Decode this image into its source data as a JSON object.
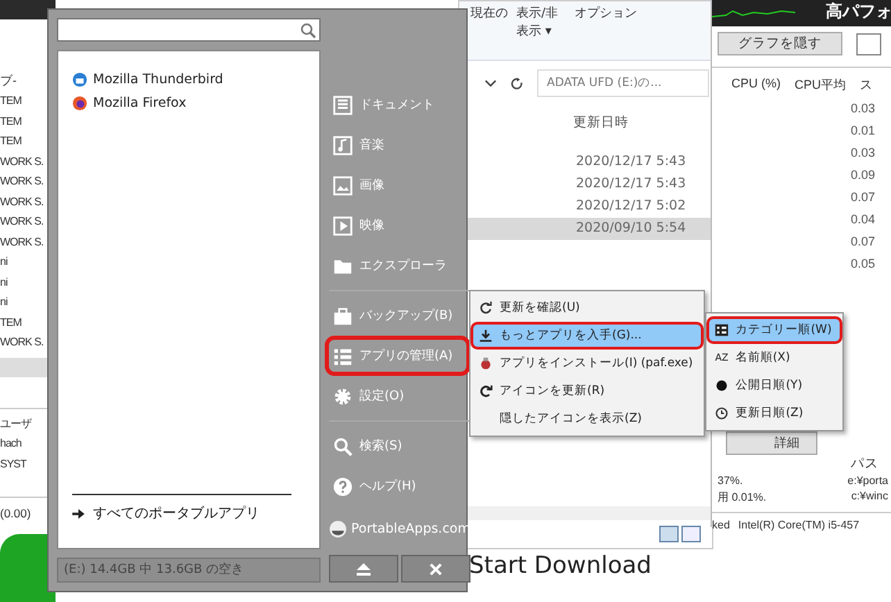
{
  "left_window": {
    "column_header": "ブ‐",
    "rows": [
      "TEM",
      "TEM",
      "TEM",
      "WORK S.",
      "WORK S.",
      "WORK S.",
      "WORK S.",
      "WORK S.",
      "ni",
      "ni",
      "ni",
      "TEM",
      "WORK S."
    ],
    "lower_header": "ユーザ",
    "lower_rows": [
      "hach",
      "SYST"
    ],
    "status": "(0.00)"
  },
  "explorer": {
    "ribbon": [
      "現在の",
      "表示/非表示 ▾",
      "オプション"
    ],
    "search_placeholder": "ADATA UFD (E:)の...",
    "column_header": "更新日時",
    "dates": [
      {
        "text": "2020/12/17 5:43",
        "selected": false
      },
      {
        "text": "2020/12/17 5:43",
        "selected": false
      },
      {
        "text": "2020/12/17 5:02",
        "selected": false
      },
      {
        "text": "2020/09/10 5:54",
        "selected": true
      }
    ],
    "below_text": "Start Download"
  },
  "task_manager": {
    "title": "高パフォ",
    "hide_graph_button": "グラフを隠す",
    "columns": [
      "CPU (%)",
      "CPU平均",
      "ス"
    ],
    "cpu_avg": [
      "0.03",
      "0.01",
      "0.03",
      "0.09",
      "0.07",
      "0.04",
      "0.07",
      "0.05"
    ],
    "details_button": "詳細",
    "lower_header": "パス",
    "lower_rows": [
      {
        "usage": "37%.",
        "path": "e:¥porta"
      },
      {
        "usage": "用 0.01%.",
        "path": "c:¥winc"
      }
    ],
    "status": [
      "ked",
      "Intel(R) Core(TM) i5-457"
    ]
  },
  "portable_menu": {
    "apps": [
      {
        "name": "Mozilla Thunderbird",
        "kind": "thunderbird"
      },
      {
        "name": "Mozilla Firefox",
        "kind": "firefox"
      }
    ],
    "all_apps": "すべてのポータブルアプリ",
    "drive": "(E:) 14.4GB 中 13.6GB の空き",
    "nav": [
      [
        {
          "label": "ドキュメント",
          "highlighted": false
        },
        {
          "label": "音楽",
          "highlighted": false
        },
        {
          "label": "画像",
          "highlighted": false
        },
        {
          "label": "映像",
          "highlighted": false
        },
        {
          "label": "エクスプローラ",
          "highlighted": false
        }
      ],
      [
        {
          "label": "バックアップ(B)",
          "highlighted": false
        },
        {
          "label": "アプリの管理(A)",
          "highlighted": true
        },
        {
          "label": "設定(O)",
          "highlighted": false
        }
      ],
      [
        {
          "label": "検索(S)",
          "highlighted": false
        },
        {
          "label": "ヘルプ(H)",
          "highlighted": false
        }
      ]
    ],
    "logo": "PortableApps.com"
  },
  "context_menu": [
    {
      "label": "更新を確認(U)",
      "kind": "refresh",
      "selected": false,
      "highlighted": false
    },
    {
      "label": "もっとアプリを入手(G)...",
      "kind": "download",
      "selected": true,
      "highlighted": true
    },
    {
      "label": "アプリをインストール(I) (paf.exe)",
      "kind": "package",
      "selected": false,
      "highlighted": false
    },
    {
      "label": "アイコンを更新(R)",
      "kind": "reload",
      "selected": false,
      "highlighted": false
    },
    {
      "label": "隠したアイコンを表示(Z)",
      "kind": "plain",
      "selected": false,
      "highlighted": false
    }
  ],
  "submenu": [
    {
      "label": "カテゴリー順(W)",
      "kind": "category",
      "selected": true,
      "highlighted": true
    },
    {
      "label": "名前順(X)",
      "kind": "text_icon",
      "icon_text": "AZ",
      "selected": false,
      "highlighted": false
    },
    {
      "label": "公開日順(Y)",
      "kind": "dot",
      "selected": false,
      "highlighted": false
    },
    {
      "label": "更新日順(Z)",
      "kind": "clock",
      "selected": false,
      "highlighted": false
    }
  ]
}
